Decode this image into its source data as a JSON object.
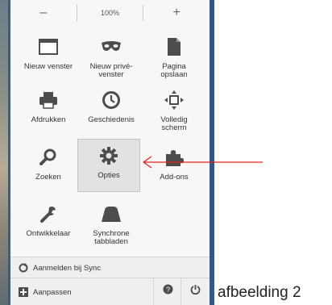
{
  "zoom": {
    "minus": "–",
    "level": "100%",
    "plus": "+"
  },
  "tiles": [
    {
      "label": "Nieuw venster",
      "icon": "window-icon"
    },
    {
      "label": "Nieuw privé-\nvenster",
      "icon": "private-mask-icon"
    },
    {
      "label": "Pagina\nopslaan",
      "icon": "page-save-icon"
    },
    {
      "label": "Afdrukken",
      "icon": "printer-icon"
    },
    {
      "label": "Geschiedenis",
      "icon": "history-clock-icon"
    },
    {
      "label": "Volledig\nscherm",
      "icon": "fullscreen-icon"
    },
    {
      "label": "Zoeken",
      "icon": "search-icon"
    },
    {
      "label": "Opties",
      "icon": "gear-icon"
    },
    {
      "label": "Add-ons",
      "icon": "puzzle-icon"
    },
    {
      "label": "Ontwikkelaar",
      "icon": "wrench-icon"
    },
    {
      "label": "Synchrone\ntabbladen",
      "icon": "synced-tabs-icon"
    }
  ],
  "footer": {
    "sync_label": "Aanmelden bij Sync",
    "customize_label": "Aanpassen"
  },
  "caption": "afbeelding 2",
  "colors": {
    "arrow": "#e0201b",
    "icon": "#4d4d4d",
    "selected_tile": "#e2e2e2"
  }
}
